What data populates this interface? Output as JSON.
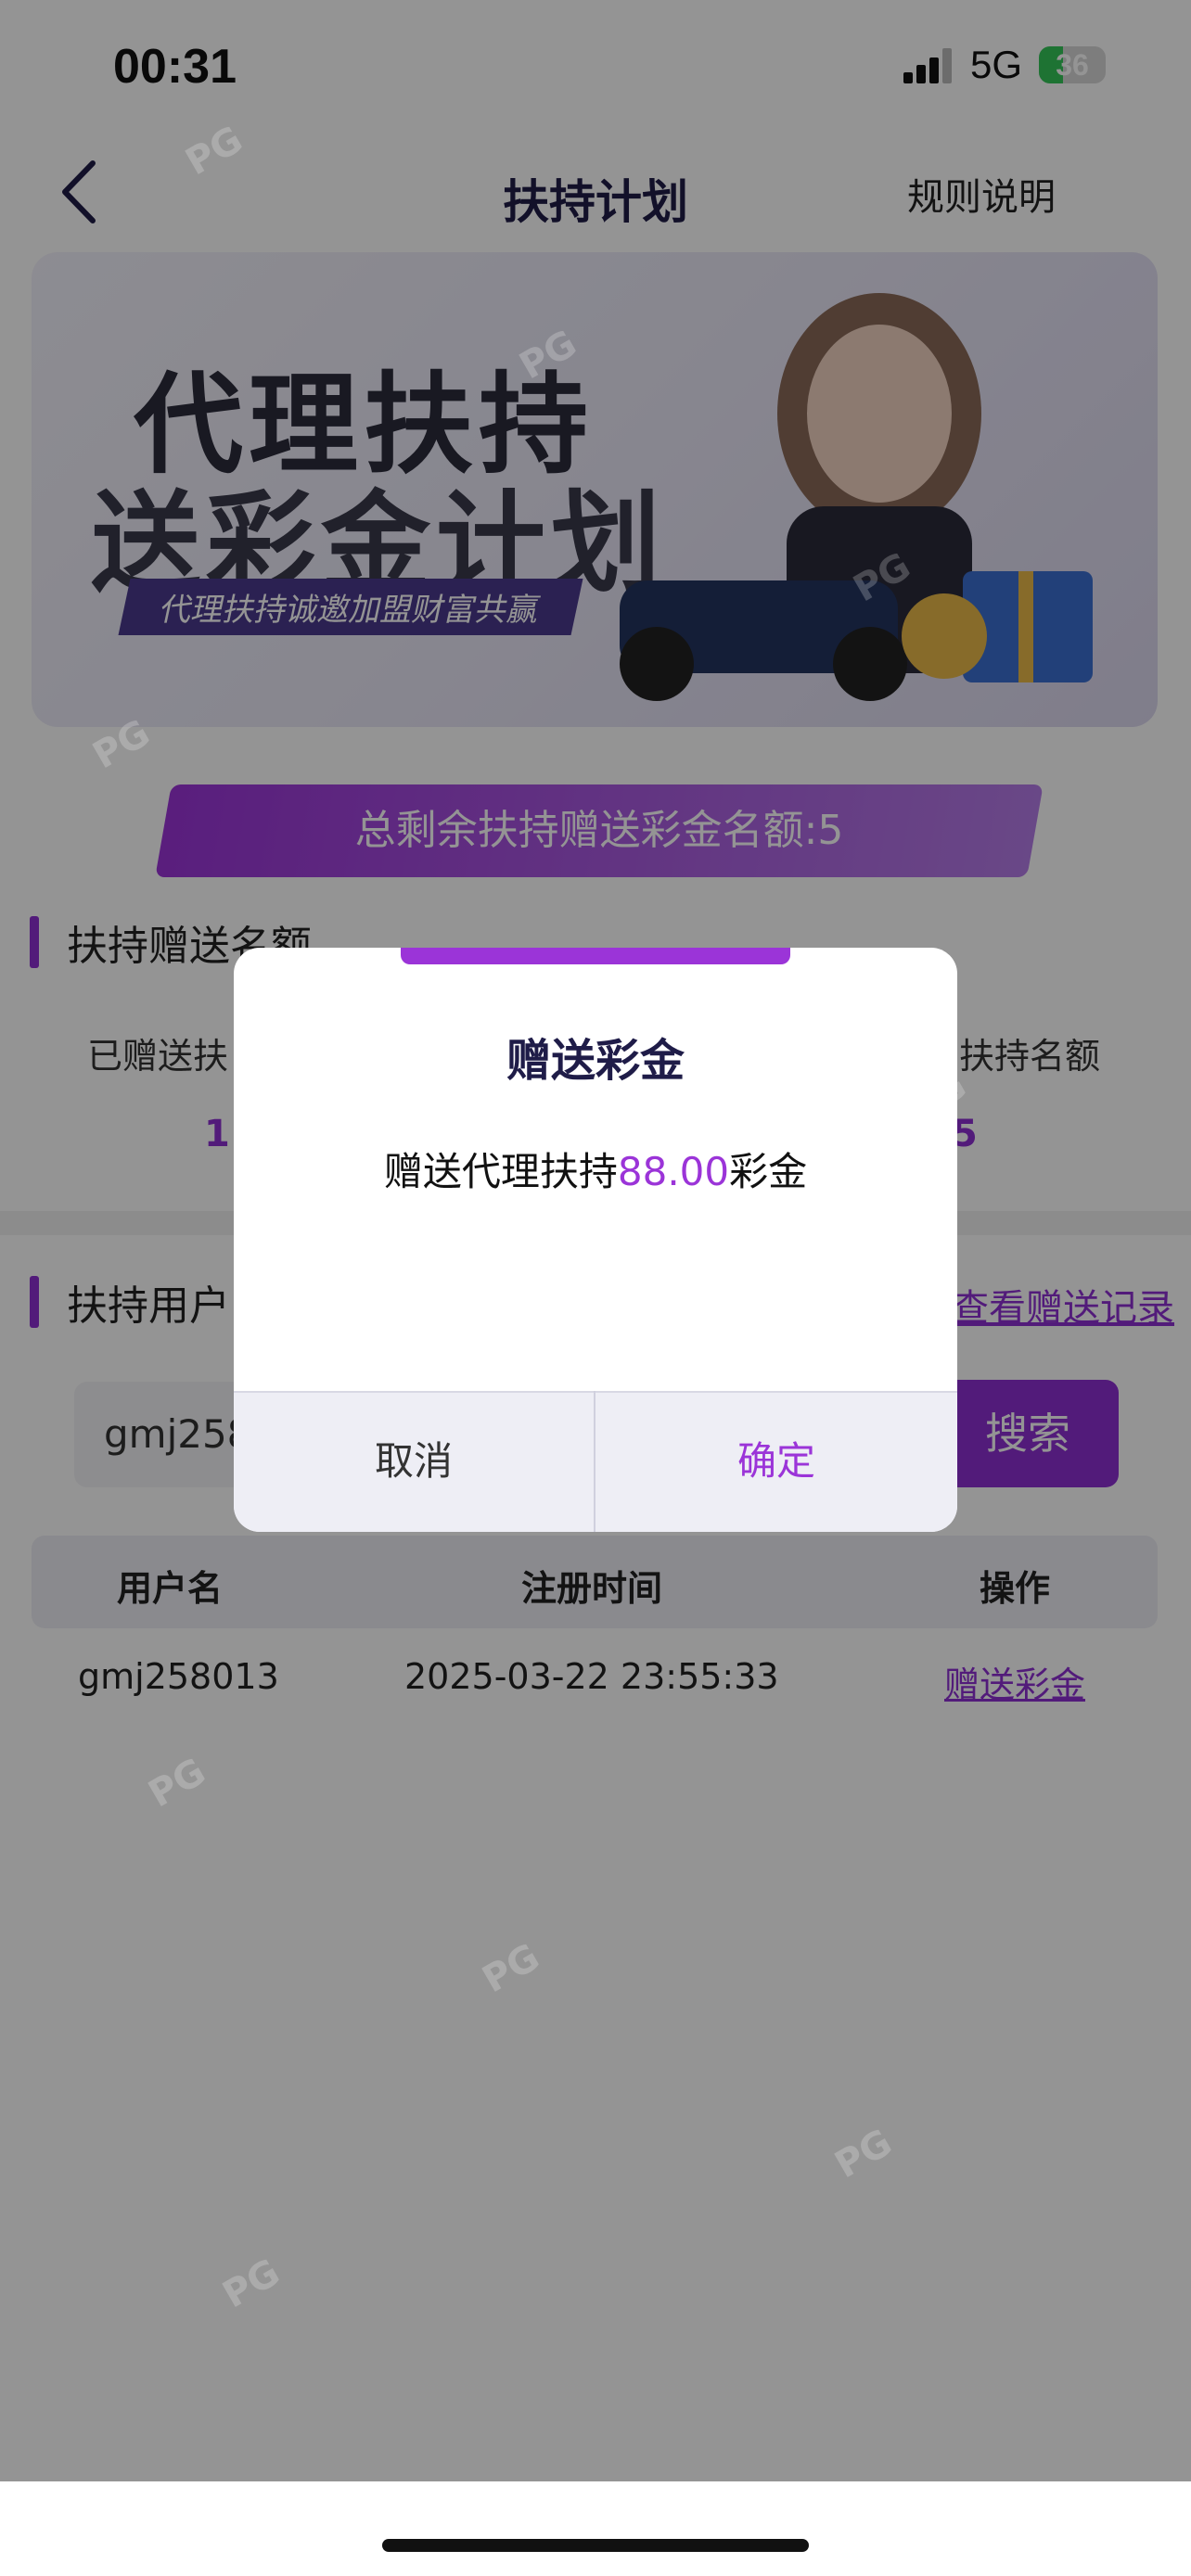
{
  "status_bar": {
    "time": "00:31",
    "network": "5G",
    "battery": "36",
    "battery_level": 0.36
  },
  "nav": {
    "title": "扶持计划",
    "rules_label": "规则说明"
  },
  "banner": {
    "line1": "代理扶持",
    "line2": "送彩金计划",
    "tagline": "代理扶持诚邀加盟财富共赢"
  },
  "quota": {
    "text": "总剩余扶持赠送彩金名额:5"
  },
  "gift_section": {
    "title": "扶持赠送名额",
    "stat1_label": "已赠送扶",
    "stat1_value": "1",
    "stat2_label": "扶持名额",
    "stat2_value": "5"
  },
  "users_section": {
    "title": "扶持用户",
    "records_link": "查看赠送记录"
  },
  "search": {
    "value": "gmj258",
    "button": "搜索"
  },
  "table": {
    "headers": [
      "用户名",
      "注册时间",
      "操作"
    ],
    "rows": [
      {
        "username": "gmj258013",
        "time": "2025-03-22 23:55:33",
        "action": "赠送彩金"
      }
    ]
  },
  "modal": {
    "title": "赠送彩金",
    "message_prefix": "赠送代理扶持",
    "amount": "88.00",
    "message_suffix": "彩金",
    "cancel": "取消",
    "confirm": "确定"
  },
  "watermark": "PG",
  "colors": {
    "accent": "#8e2fd3",
    "nav_title": "#1f1c48",
    "overlay": "rgba(0,0,0,0.42)"
  }
}
